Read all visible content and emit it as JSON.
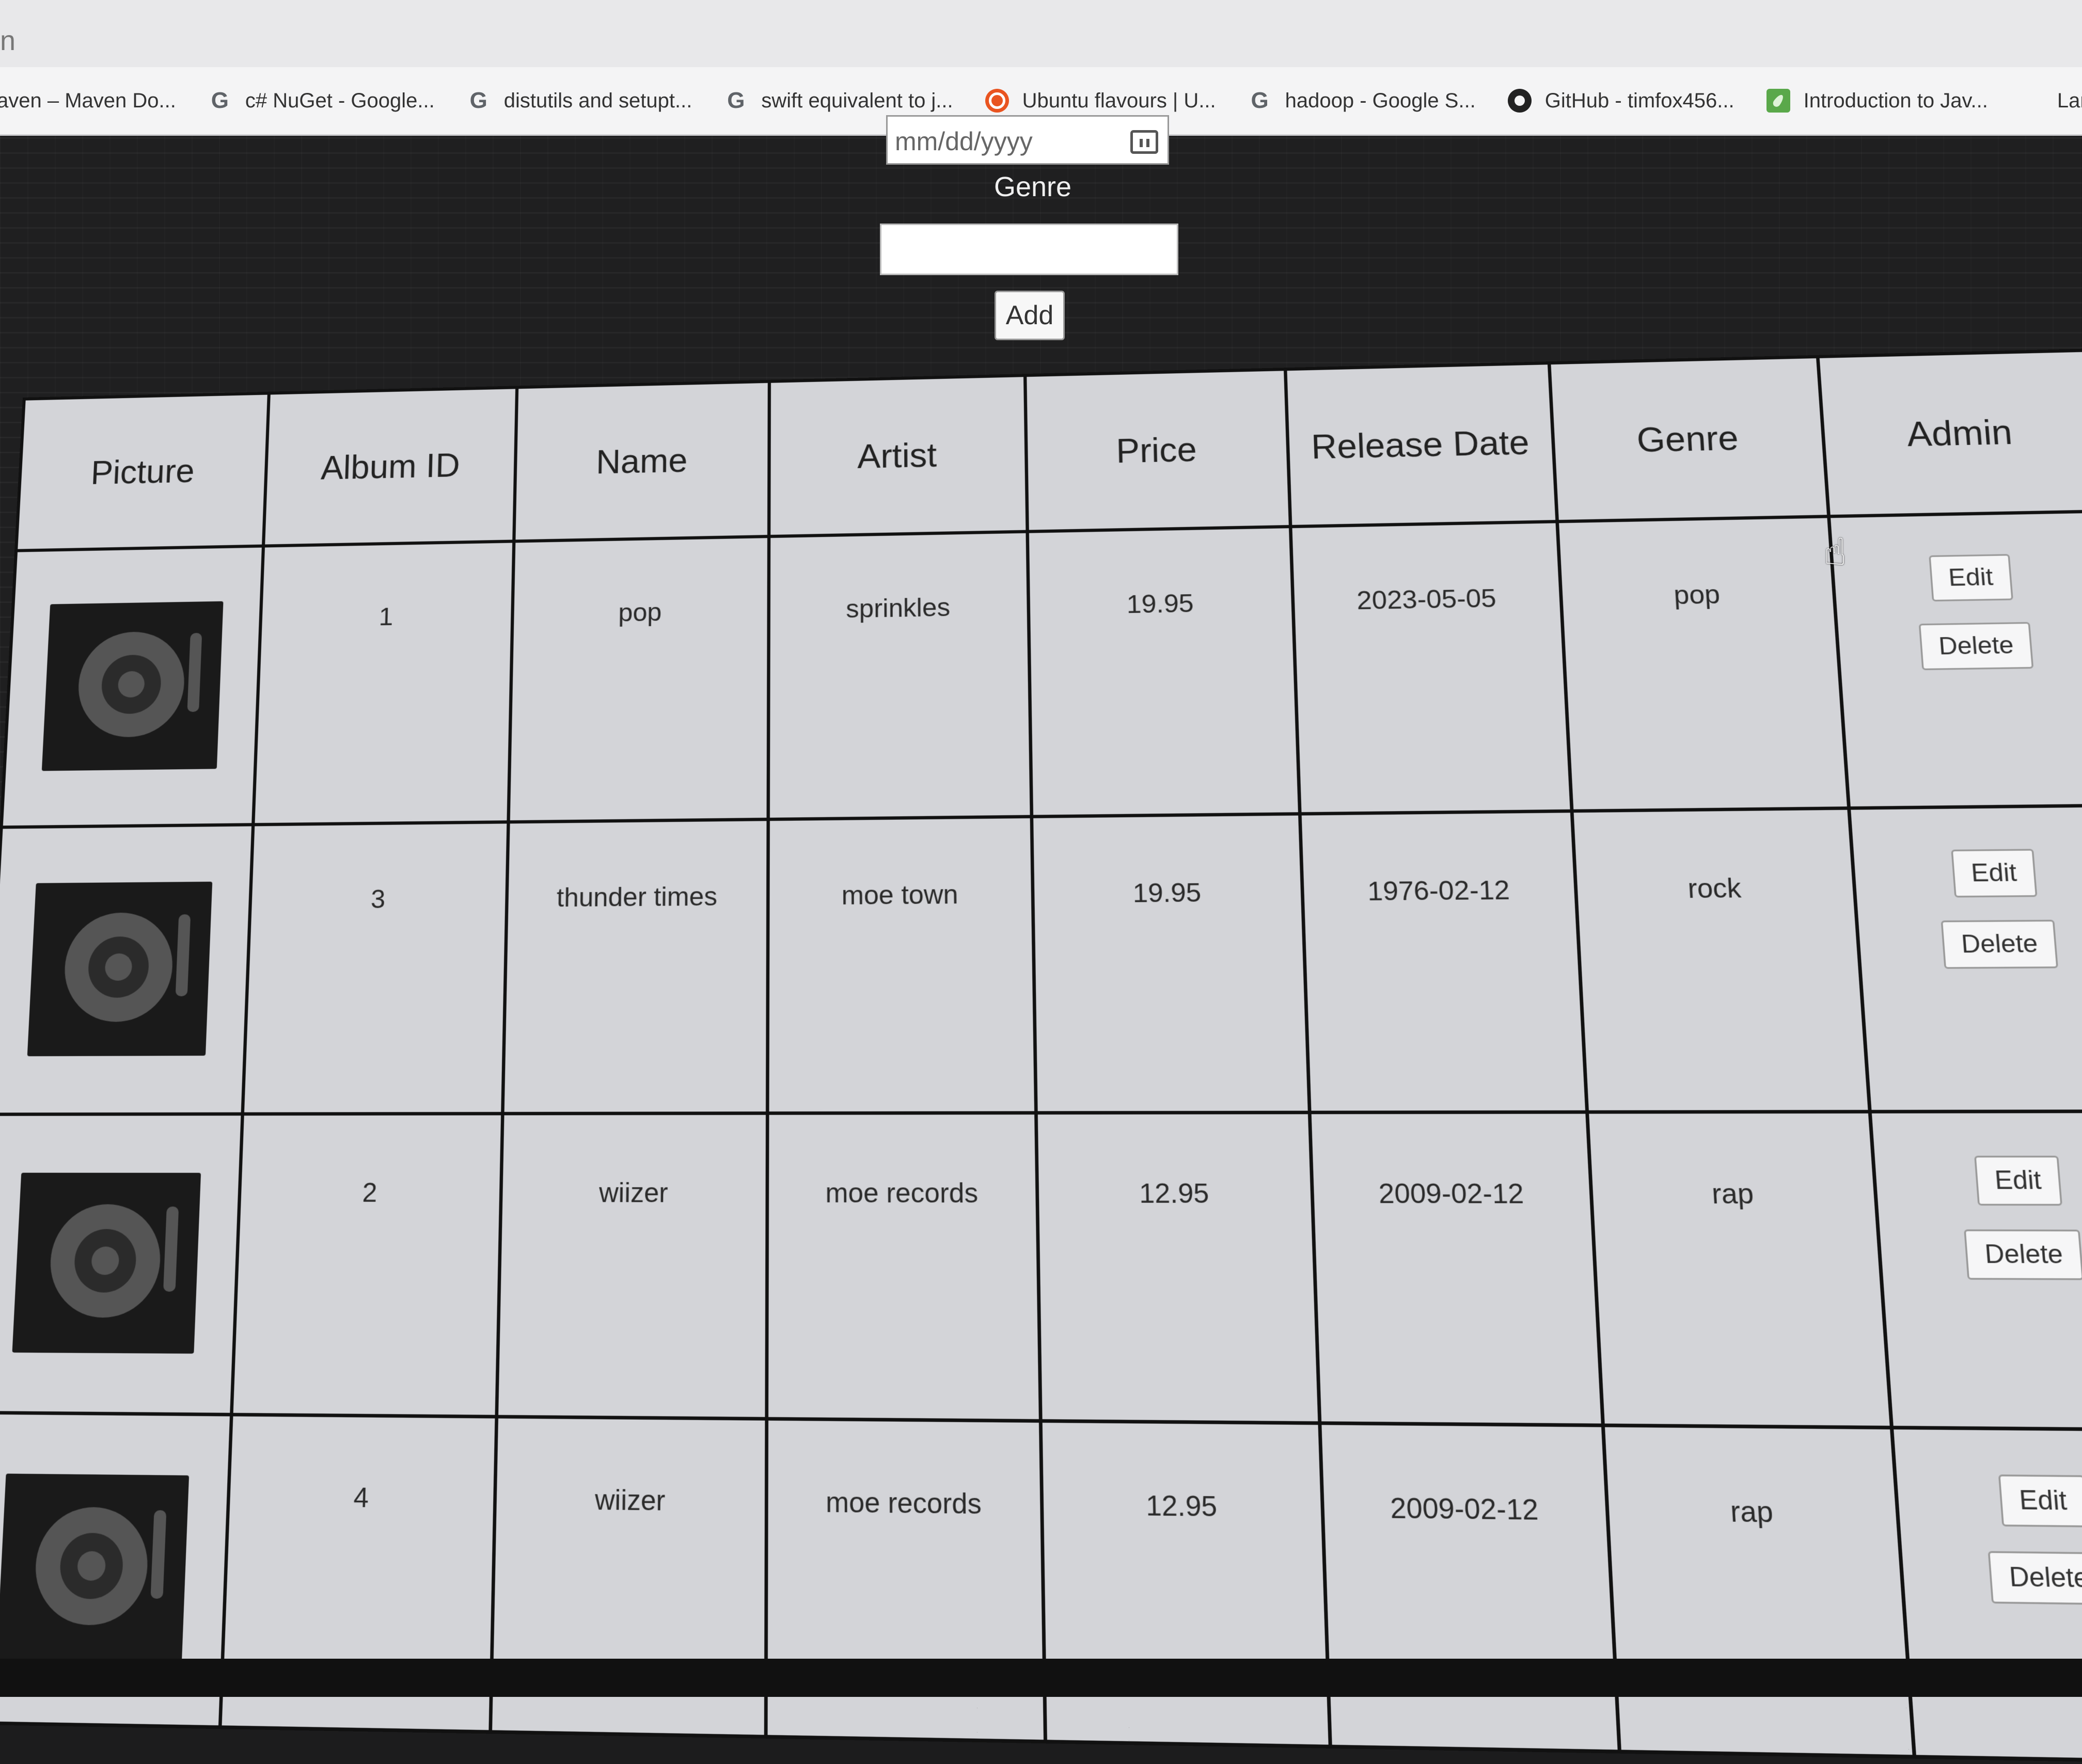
{
  "browser": {
    "tab_fragment": "n",
    "bookmarks": [
      {
        "icon": "none",
        "label": "aven – Maven Do..."
      },
      {
        "icon": "google-icon",
        "label": "c# NuGet - Google..."
      },
      {
        "icon": "google-icon",
        "label": "distutils and setupt..."
      },
      {
        "icon": "google-icon",
        "label": "swift equivalent to j..."
      },
      {
        "icon": "ubuntu-icon",
        "label": "Ubuntu flavours | U..."
      },
      {
        "icon": "google-icon",
        "label": "hadoop - Google S..."
      },
      {
        "icon": "github-icon",
        "label": "GitHub - timfox456..."
      },
      {
        "icon": "leaf-icon",
        "label": "Introduction to Jav..."
      },
      {
        "icon": "microsoft-icon",
        "label": "Langu"
      }
    ]
  },
  "form": {
    "date_placeholder": "mm/dd/yyyy",
    "genre_label": "Genre",
    "genre_value": "",
    "add_label": "Add"
  },
  "table": {
    "headers": [
      "Picture",
      "Album ID",
      "Name",
      "Artist",
      "Price",
      "Release Date",
      "Genre",
      "Admin"
    ],
    "rows": [
      {
        "album_id": "1",
        "name": "pop",
        "artist": "sprinkles",
        "price": "19.95",
        "release_date": "2023-05-05",
        "genre": "pop",
        "edit_label": "Edit",
        "delete_label": "Delete"
      },
      {
        "album_id": "3",
        "name": "thunder times",
        "artist": "moe town",
        "price": "19.95",
        "release_date": "1976-02-12",
        "genre": "rock",
        "edit_label": "Edit",
        "delete_label": "Delete"
      },
      {
        "album_id": "2",
        "name": "wiizer",
        "artist": "moe records",
        "price": "12.95",
        "release_date": "2009-02-12",
        "genre": "rap",
        "edit_label": "Edit",
        "delete_label": "Delete"
      },
      {
        "album_id": "4",
        "name": "wiizer",
        "artist": "moe records",
        "price": "12.95",
        "release_date": "2009-02-12",
        "genre": "rap",
        "edit_label": "Edit",
        "delete_label": "Delete"
      }
    ]
  },
  "colors": {
    "page_background": "#1f1f20",
    "table_background": "#d3d4d8",
    "table_border": "#111111",
    "button_background": "#f6f6f7"
  }
}
